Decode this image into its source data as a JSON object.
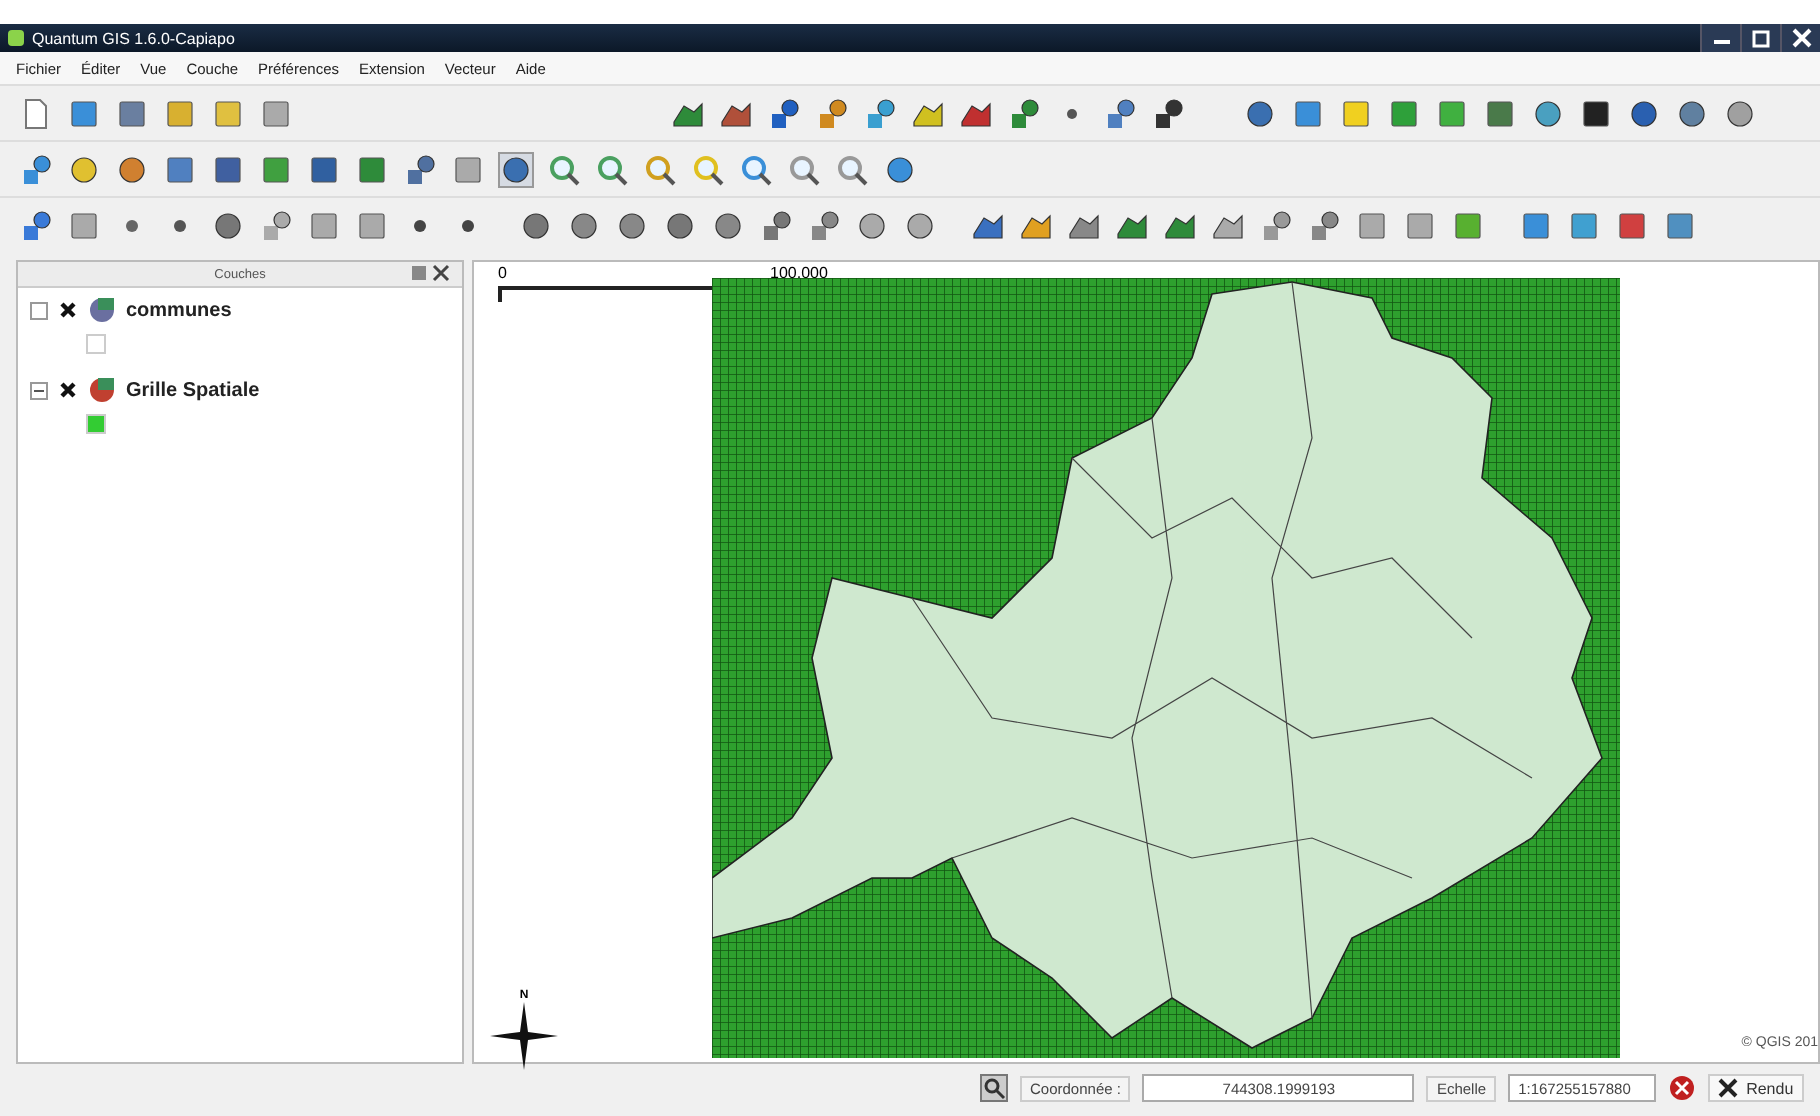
{
  "window": {
    "title": "Quantum GIS 1.6.0-Capiapo"
  },
  "menu": [
    "Fichier",
    "Éditer",
    "Vue",
    "Couche",
    "Préférences",
    "Extension",
    "Vecteur",
    "Aide"
  ],
  "layers_panel": {
    "title": "Couches",
    "layers": [
      {
        "name": "communes",
        "expanded": false,
        "color": "#ffffff"
      },
      {
        "name": "Grille Spatiale",
        "expanded": true,
        "color": "#33cc33"
      }
    ]
  },
  "map": {
    "scale_bar": {
      "start": "0",
      "end": "100,000"
    },
    "north_label": "N",
    "copyright": "© QGIS 201"
  },
  "status_bar": {
    "coordinate_label": "Coordonnée :",
    "coordinate": "744308.1999193",
    "scale_label": "Echelle",
    "scale": "1:167255157880",
    "render_label": "Rendu",
    "render_checked": true
  }
}
